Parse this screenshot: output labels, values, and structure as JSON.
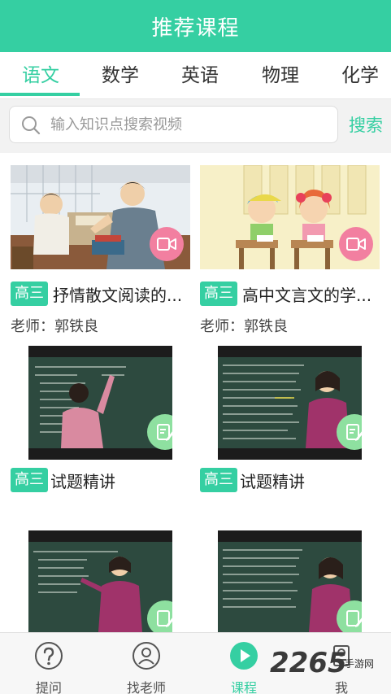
{
  "header": {
    "title": "推荐课程"
  },
  "tabs": [
    {
      "label": "语文",
      "active": true
    },
    {
      "label": "数学",
      "active": false
    },
    {
      "label": "英语",
      "active": false
    },
    {
      "label": "物理",
      "active": false
    },
    {
      "label": "化学",
      "active": false
    }
  ],
  "search": {
    "placeholder": "输入知识点搜索视频",
    "value": "",
    "button_label": "搜索"
  },
  "courses": [
    {
      "grade": "高三",
      "title": "抒情散文阅读的...",
      "teacher": "老师：郭铁良"
    },
    {
      "grade": "高三",
      "title": "高中文言文的学...",
      "teacher": "老师：郭铁良"
    },
    {
      "grade": "高三",
      "title": "试题精讲"
    },
    {
      "grade": "高三",
      "title": "试题精讲"
    }
  ],
  "bottom_nav": [
    {
      "label": "提问",
      "icon": "question-icon",
      "active": false
    },
    {
      "label": "找老师",
      "icon": "teacher-icon",
      "active": false
    },
    {
      "label": "课程",
      "icon": "play-icon",
      "active": true
    },
    {
      "label": "我",
      "icon": "profile-icon",
      "active": false
    }
  ],
  "watermark": {
    "number": "2265",
    "site": "手游网"
  },
  "colors": {
    "accent": "#35cfa2",
    "video_badge": "#f27fa0",
    "edit_badge": "#8ee0a0",
    "board": "#2d4a3f"
  }
}
